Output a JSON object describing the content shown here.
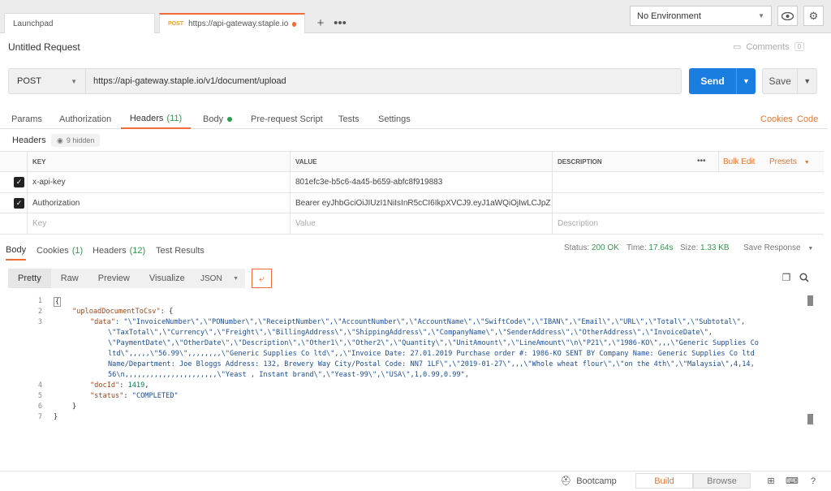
{
  "tabs": [
    {
      "label": "Launchpad"
    },
    {
      "method": "POST",
      "label": "https://api-gateway.staple.io/v..."
    }
  ],
  "environment": {
    "selected": "No Environment"
  },
  "request": {
    "title": "Untitled Request",
    "comments_label": "Comments",
    "comments_count": "0",
    "method": "POST",
    "url": "https://api-gateway.staple.io/v1/document/upload",
    "send_label": "Send",
    "save_label": "Save"
  },
  "request_tabs": {
    "params": "Params",
    "authorization": "Authorization",
    "headers": "Headers",
    "headers_count": "(11)",
    "body": "Body",
    "prerequest": "Pre-request Script",
    "tests": "Tests",
    "settings": "Settings",
    "cookies": "Cookies",
    "code": "Code"
  },
  "headers_section": {
    "label": "Headers",
    "hidden": "9 hidden",
    "columns": {
      "key": "KEY",
      "value": "VALUE",
      "description": "DESCRIPTION"
    },
    "bulk_edit": "Bulk Edit",
    "presets": "Presets",
    "rows": [
      {
        "key": "x-api-key",
        "value": "801efc3e-b5c6-4a45-b659-abfc8f919883"
      },
      {
        "key": "Authorization",
        "value": "Bearer eyJhbGciOiJIUzI1NiIsInR5cCI6IkpXVCJ9.eyJ1aWQiOjIwLCJpZ ..."
      }
    ],
    "placeholder": {
      "key": "Key",
      "value": "Value",
      "description": "Description"
    }
  },
  "response": {
    "tabs": {
      "body": "Body",
      "cookies": "Cookies",
      "cookies_count": "(1)",
      "headers": "Headers",
      "headers_count": "(12)",
      "test_results": "Test Results"
    },
    "status_label": "Status:",
    "status": "200 OK",
    "time_label": "Time:",
    "time": "17.64s",
    "size_label": "Size:",
    "size": "1.33 KB",
    "save_response": "Save Response",
    "view_modes": [
      "Pretty",
      "Raw",
      "Preview",
      "Visualize"
    ],
    "format": "JSON",
    "code": {
      "l1": "{",
      "l2_key": "\"uploadDocumentToCsv\"",
      "l2_rest": ": {",
      "l3_key": "\"data\"",
      "l3_a": ": \"\\\"InvoiceNumber\\\",\\\"PONumber\\\",\\\"ReceiptNumber\\\",\\\"AccountNumber\\\",\\\"AccountName\\\",\\\"SwiftCode\\\",\\\"IBAN\\\",\\\"Email\\\",\\\"URL\\\",\\\"Total\\\",\\\"Subtotal\\\",",
      "l3_b": "\\\"TaxTotal\\\",\\\"Currency\\\",\\\"Freight\\\",\\\"BillingAddress\\\",\\\"ShippingAddress\\\",\\\"CompanyName\\\",\\\"SenderAddress\\\",\\\"OtherAddress\\\",\\\"InvoiceDate\\\",",
      "l3_c": "\\\"PaymentDate\\\",\\\"OtherDate\\\",\\\"Description\\\",\\\"Other1\\\",\\\"Other2\\\",\\\"Quantity\\\",\\\"UnitAmount\\\",\\\"LineAmount\\\"\\n\\\"P21\\\",\\\"1986-KO\\\",,,\\\"Generic Supplies Co",
      "l3_d": "ltd\\\",,,,,\\\"56.99\\\",,,,,,,,\\\"Generic Supplies Co ltd\\\",,\\\"Invoice Date: 27.01.2019 Purchase order #: 1986-KO SENT BY Company Name: Generic Supplies Co ltd",
      "l3_e": "Name/Department: Joe Bloggs Address: 132, Brewery Way City/Postal Code: NN7 1LF\\\",\\\"2019-01-27\\\",,,\\\"Whole wheat flour\\\",\\\"on the 4th\\\",\\\"Malaysia\\\",4,14,",
      "l3_f": "56\\n,,,,,,,,,,,,,,,,,,,,,,\\\"Yeast , Instant brand\\\",\\\"Yeast-99\\\",\\\"USA\\\",1,0.99,0.99\",",
      "l4_key": "\"docId\"",
      "l4_val": "1419",
      "l5_key": "\"status\"",
      "l5_val": "\"COMPLETED\"",
      "l6": "}",
      "l7": "}"
    },
    "line_numbers": [
      "1",
      "2",
      "3",
      "4",
      "5",
      "6",
      "7"
    ]
  },
  "statusbar": {
    "bootcamp": "Bootcamp",
    "build": "Build",
    "browse": "Browse"
  },
  "colors": {
    "accent": "#f26b3a",
    "send": "#1a7ee0",
    "ok": "#2e9b4a"
  }
}
